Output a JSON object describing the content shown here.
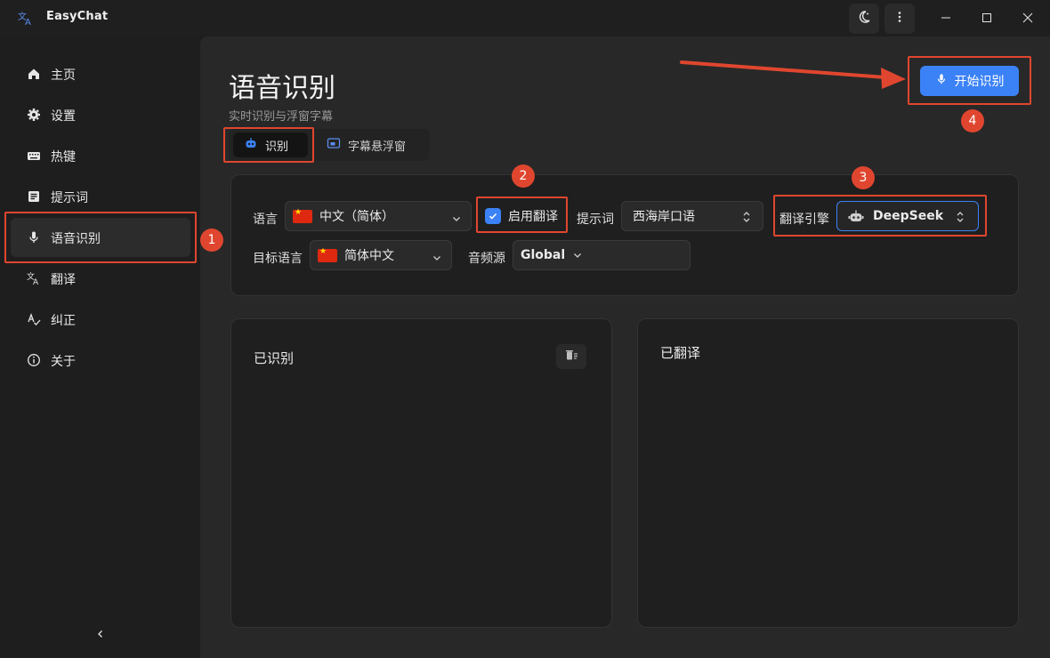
{
  "app": {
    "title": "EasyChat"
  },
  "sidebar": {
    "items": [
      {
        "label": "主页",
        "icon": "home-icon"
      },
      {
        "label": "设置",
        "icon": "gear-icon"
      },
      {
        "label": "热键",
        "icon": "keyboard-icon"
      },
      {
        "label": "提示词",
        "icon": "document-icon"
      },
      {
        "label": "语音识别",
        "icon": "microphone-icon",
        "active": true
      },
      {
        "label": "翻译",
        "icon": "translate-icon"
      },
      {
        "label": "纠正",
        "icon": "spellcheck-icon"
      },
      {
        "label": "关于",
        "icon": "info-icon"
      }
    ]
  },
  "page": {
    "title": "语音识别",
    "subtitle": "实时识别与浮窗字幕",
    "start_button": "开始识别"
  },
  "tabs": [
    {
      "label": "识别",
      "icon": "robot-icon",
      "selected": true
    },
    {
      "label": "字幕悬浮窗",
      "icon": "picture-in-picture-icon"
    }
  ],
  "config": {
    "language_label": "语言",
    "language_value": "中文（简体）",
    "enable_translation_label": "启用翻译",
    "enable_translation_checked": true,
    "prompt_label": "提示词",
    "prompt_value": "西海岸口语",
    "engine_label": "翻译引擎",
    "engine_value": "DeepSeek",
    "target_language_label": "目标语言",
    "target_language_value": "简体中文",
    "audio_source_label": "音频源",
    "audio_source_value": "Global"
  },
  "panels": {
    "recognized_title": "已识别",
    "translated_title": "已翻译"
  },
  "annotations": [
    "1",
    "2",
    "3",
    "4"
  ],
  "colors": {
    "accent": "#3b82f6",
    "annotation": "#e0462f"
  }
}
